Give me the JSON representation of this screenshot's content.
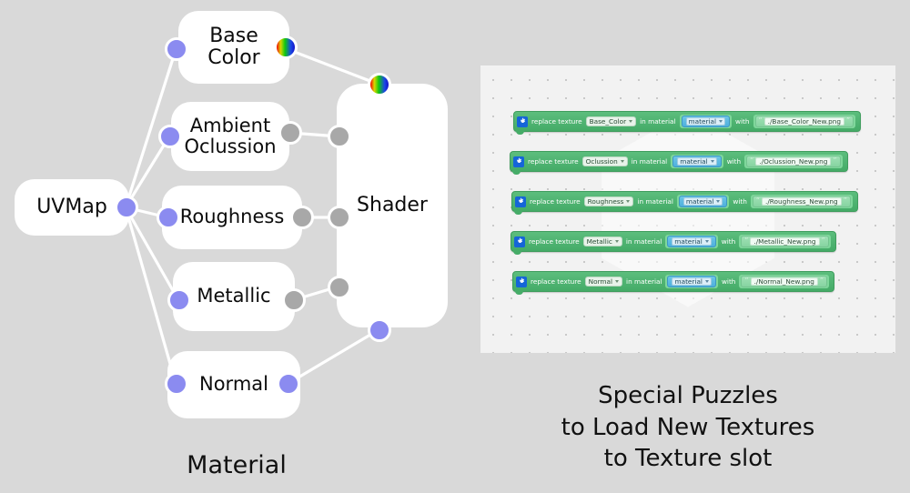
{
  "material_graph": {
    "caption": "Material",
    "nodes": [
      {
        "id": "uvmap",
        "label": "UVMap"
      },
      {
        "id": "base_color",
        "label": "Base\nColor"
      },
      {
        "id": "ambient_occlusion",
        "label": "Ambient\nOclussion"
      },
      {
        "id": "roughness",
        "label": "Roughness"
      },
      {
        "id": "metallic",
        "label": "Metallic"
      },
      {
        "id": "normal",
        "label": "Normal"
      },
      {
        "id": "shader",
        "label": "Shader"
      }
    ],
    "socket_colors": {
      "vector": "#8b8bf0",
      "value": "#a8a8a8",
      "color": "rainbow"
    },
    "background": "#d9d9d9"
  },
  "blockly": {
    "caption": "Special Puzzles\nto Load New Textures\nto Texture slot",
    "caption_lines": [
      "Special Puzzles",
      "to Load New Textures",
      "to Texture slot"
    ],
    "workspace_bg": "#f2f2f2",
    "block_color": "#4cb26f",
    "blocks": [
      {
        "icon": "gear-icon",
        "verb": "replace texture",
        "texture": "Base_Color",
        "in_material": "in material",
        "material": "material",
        "with": "with",
        "path": "./Base_Color_New.png",
        "quote_open": "“",
        "quote_close": "”"
      },
      {
        "icon": "gear-icon",
        "verb": "replace texture",
        "texture": "Oclussion",
        "in_material": "in material",
        "material": "material",
        "with": "with",
        "path": "./Oclussion_New.png",
        "quote_open": "“",
        "quote_close": "”"
      },
      {
        "icon": "gear-icon",
        "verb": "replace texture",
        "texture": "Roughness",
        "in_material": "in material",
        "material": "material",
        "with": "with",
        "path": "./Roughness_New.png",
        "quote_open": "“",
        "quote_close": "”"
      },
      {
        "icon": "gear-icon",
        "verb": "replace texture",
        "texture": "Metallic",
        "in_material": "in material",
        "material": "material",
        "with": "with",
        "path": "./Metallic_New.png",
        "quote_open": "“",
        "quote_close": "”"
      },
      {
        "icon": "gear-icon",
        "verb": "replace texture",
        "texture": "Normal",
        "in_material": "in material",
        "material": "material",
        "with": "with",
        "path": "./Normal_New.png",
        "quote_open": "“",
        "quote_close": "”"
      }
    ]
  }
}
